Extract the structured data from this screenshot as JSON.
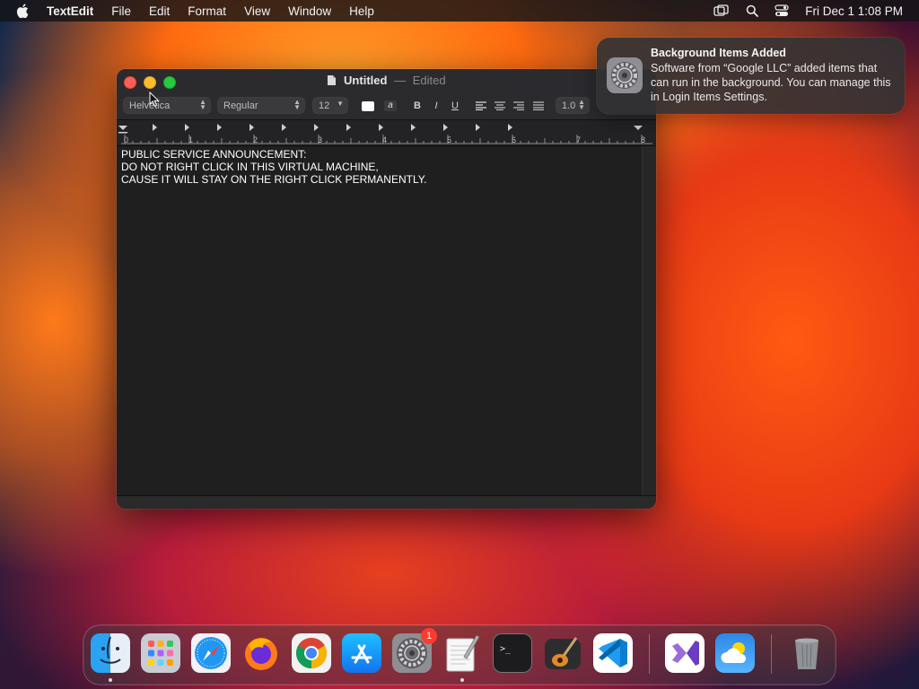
{
  "menubar": {
    "app_name": "TextEdit",
    "items": [
      "File",
      "Edit",
      "Format",
      "View",
      "Window",
      "Help"
    ],
    "clock": "Fri Dec 1  1:08 PM"
  },
  "window": {
    "title": "Untitled",
    "title_separator": "—",
    "status": "Edited",
    "toolbar": {
      "font_family": "Helvetica",
      "font_style": "Regular",
      "font_size": "12",
      "bold": "B",
      "italic": "I",
      "underline": "U",
      "line_spacing": "1.0"
    },
    "ruler_numbers": [
      "0",
      "1",
      "2",
      "3",
      "4",
      "5",
      "6",
      "7",
      "8"
    ],
    "document_lines": [
      "PUBLIC SERVICE ANNOUNCEMENT:",
      "",
      "DO NOT RIGHT CLICK IN THIS VIRTUAL MACHINE,",
      "CAUSE IT WILL STAY ON THE RIGHT CLICK PERMANENTLY."
    ]
  },
  "notification": {
    "title": "Background Items Added",
    "body": "Software from “Google LLC” added items that can run in the background. You can manage this in Login Items Settings."
  },
  "dock": {
    "items": [
      {
        "name": "Finder",
        "icon": "finder-icon",
        "running": true
      },
      {
        "name": "Launchpad",
        "icon": "launchpad-icon",
        "running": false
      },
      {
        "name": "Safari",
        "icon": "safari-icon",
        "running": false
      },
      {
        "name": "Firefox",
        "icon": "firefox-icon",
        "running": false
      },
      {
        "name": "Google Chrome",
        "icon": "chrome-icon",
        "running": false
      },
      {
        "name": "App Store",
        "icon": "app-store-icon",
        "running": false
      },
      {
        "name": "System Settings",
        "icon": "settings-icon",
        "running": false,
        "badge": "1"
      },
      {
        "name": "TextEdit",
        "icon": "textedit-icon",
        "running": true
      },
      {
        "name": "Terminal",
        "icon": "terminal-icon",
        "running": false
      },
      {
        "name": "GarageBand",
        "icon": "garageband-icon",
        "running": false
      },
      {
        "name": "Visual Studio Code",
        "icon": "vscode-icon",
        "running": false
      },
      {
        "name": "Visual Studio",
        "icon": "visual-studio-icon",
        "running": false
      },
      {
        "name": "Weather",
        "icon": "weather-icon",
        "running": false
      },
      {
        "name": "Trash",
        "icon": "trash-icon",
        "running": false
      }
    ]
  },
  "colors": {
    "close": "#ff5f57",
    "minimize": "#febc2e",
    "maximize": "#28c840",
    "badge": "#ff3b30"
  }
}
